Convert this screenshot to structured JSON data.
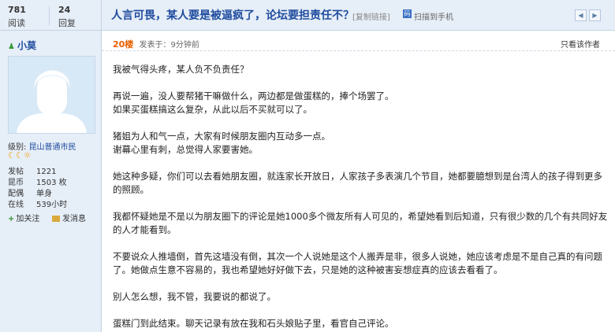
{
  "stats": {
    "views": {
      "num": "781",
      "label": "阅读"
    },
    "replies": {
      "num": "24",
      "label": "回复"
    }
  },
  "header": {
    "title": "人言可畏，某人要是被逼疯了，论坛要担责任不？",
    "copy_link": "[复制链接]",
    "qr_icon_text": "码",
    "scan_to_phone": "扫描到手机",
    "prev": "◀",
    "next": "▶"
  },
  "user": {
    "name": "小莫",
    "level_label": "级别:",
    "level_value": "昆山普通市民",
    "moons": "☾☾☼",
    "rows": [
      {
        "k": "发帖",
        "v": "1221"
      },
      {
        "k": "昆币",
        "v": "1503 枚"
      },
      {
        "k": "配偶",
        "v": "单身"
      },
      {
        "k": "在线",
        "v": "539小时"
      }
    ],
    "add_follow": "加关注",
    "send_message": "发消息"
  },
  "post": {
    "floor": "20楼",
    "posted": "发表于：9分钟前",
    "only_author": "只看该作者",
    "paragraphs": [
      "我被气得头疼，某人负不负责任？",
      "",
      "再说一遍，没人要帮猪干嘛做什么，两边都是做蛋糕的，捧个场罢了。",
      "如果买蛋糕搞这么复杂，从此以后不买就可以了。",
      "",
      "猪姐为人和气一点，大家有时候朋友圈内互动多一点。",
      "谢幕心里有刺，总觉得人家要害她。",
      "",
      "她这种多疑，你们可以去看她朋友圈，就连家长开放日，人家孩子多表演几个节目，她都要臆想到是台湾人的孩子得到更多的照顾。",
      "",
      "我都怀疑她是不是以为朋友圈下的评论是她1000多个微友所有人可见的，希望她看到后知道，只有很少数的几个有共同好友的人才能看到。",
      "",
      "不要说众人推墙倒，首先这墙没有倒，其次一个人说她是这个人搬弄是非，很多人说她，她应该考虑是不是自己真的有问题了。她做点生意不容易的，我也希望她好好做下去，只是她的这种被害妄想症真的应该去看看了。",
      "",
      "别人怎么想，我不管，我要说的都说了。",
      "",
      "蛋糕门到此结束。聊天记录有放在我和石头娘贴子里，看官自己评论。"
    ]
  }
}
